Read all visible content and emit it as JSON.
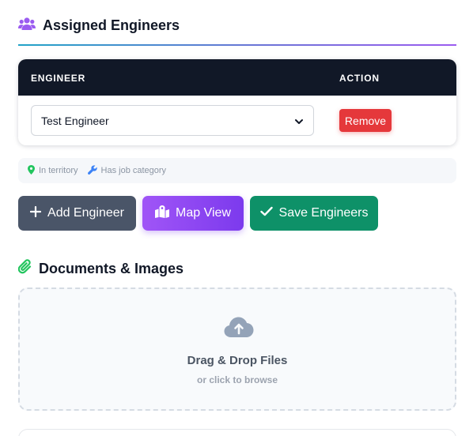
{
  "assigned": {
    "title": "Assigned Engineers",
    "icon": "users-icon",
    "accent": "#9b5cf0"
  },
  "table": {
    "headers": {
      "engineer": "ENGINEER",
      "action": "ACTION"
    },
    "rows": [
      {
        "engineer": "Test Engineer",
        "action": "Remove"
      }
    ]
  },
  "legend": {
    "territory": "In territory",
    "job_category": "Has job category"
  },
  "buttons": {
    "add": "Add Engineer",
    "map": "Map View",
    "save": "Save Engineers"
  },
  "documents": {
    "title": "Documents & Images",
    "icon": "paperclip-icon",
    "drop_title": "Drag & Drop Files",
    "drop_sub": "or click to browse"
  },
  "colors": {
    "header_bg": "#111827",
    "remove": "#e5383b",
    "add": "#4a5568",
    "map": "#7c3aed",
    "save": "#0e9168"
  }
}
